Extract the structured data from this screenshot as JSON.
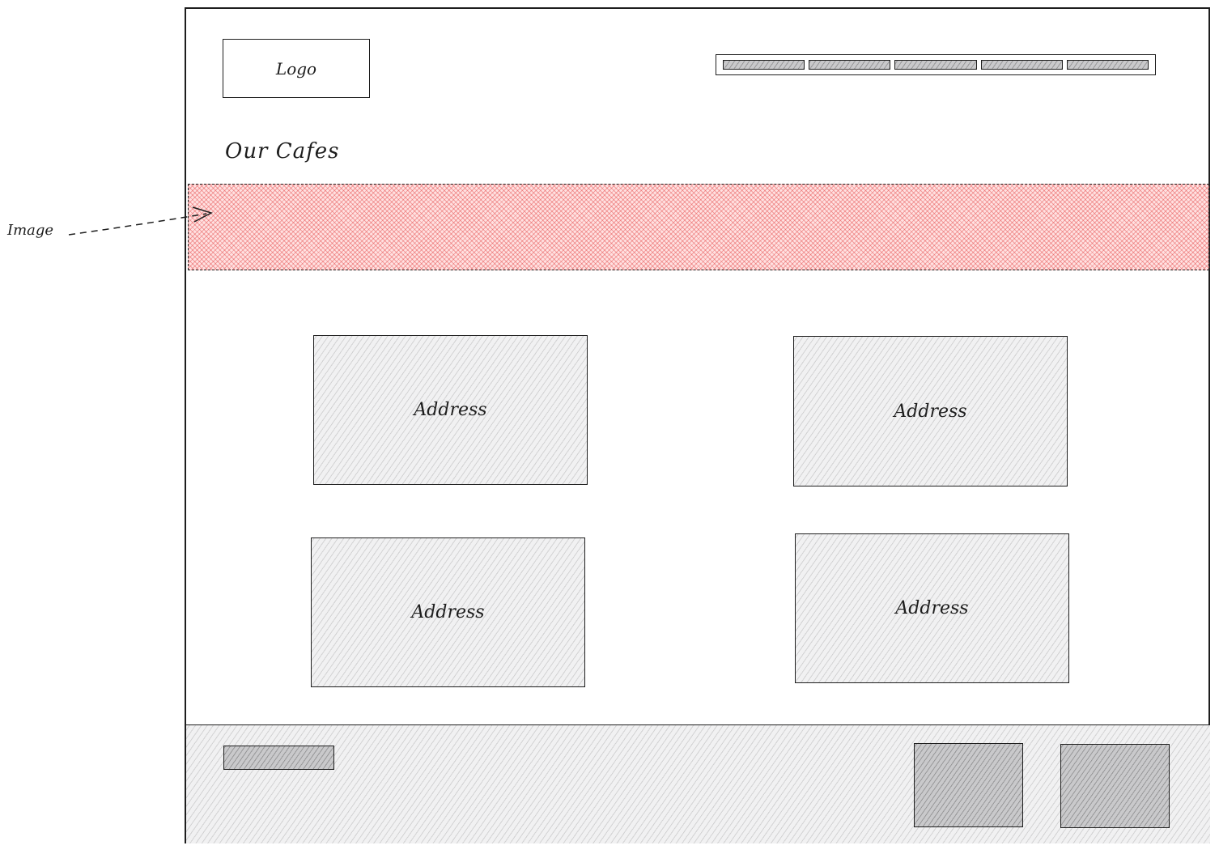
{
  "header": {
    "logo_label": "Logo",
    "nav_items": [
      "",
      "",
      "",
      "",
      ""
    ]
  },
  "main": {
    "title": "Our Cafes",
    "hero": {
      "annotation": "Image",
      "fill_color": "#e03131"
    },
    "cafes": [
      {
        "label": "Address"
      },
      {
        "label": "Address"
      },
      {
        "label": "Address"
      },
      {
        "label": "Address"
      }
    ]
  },
  "footer": {
    "link_placeholder": "",
    "social_icons": [
      "social-icon",
      "social-icon"
    ]
  },
  "colors": {
    "stroke": "#1e1e1e",
    "hatch_gray": "#f1f1f2",
    "hatch_red": "#e03131"
  }
}
